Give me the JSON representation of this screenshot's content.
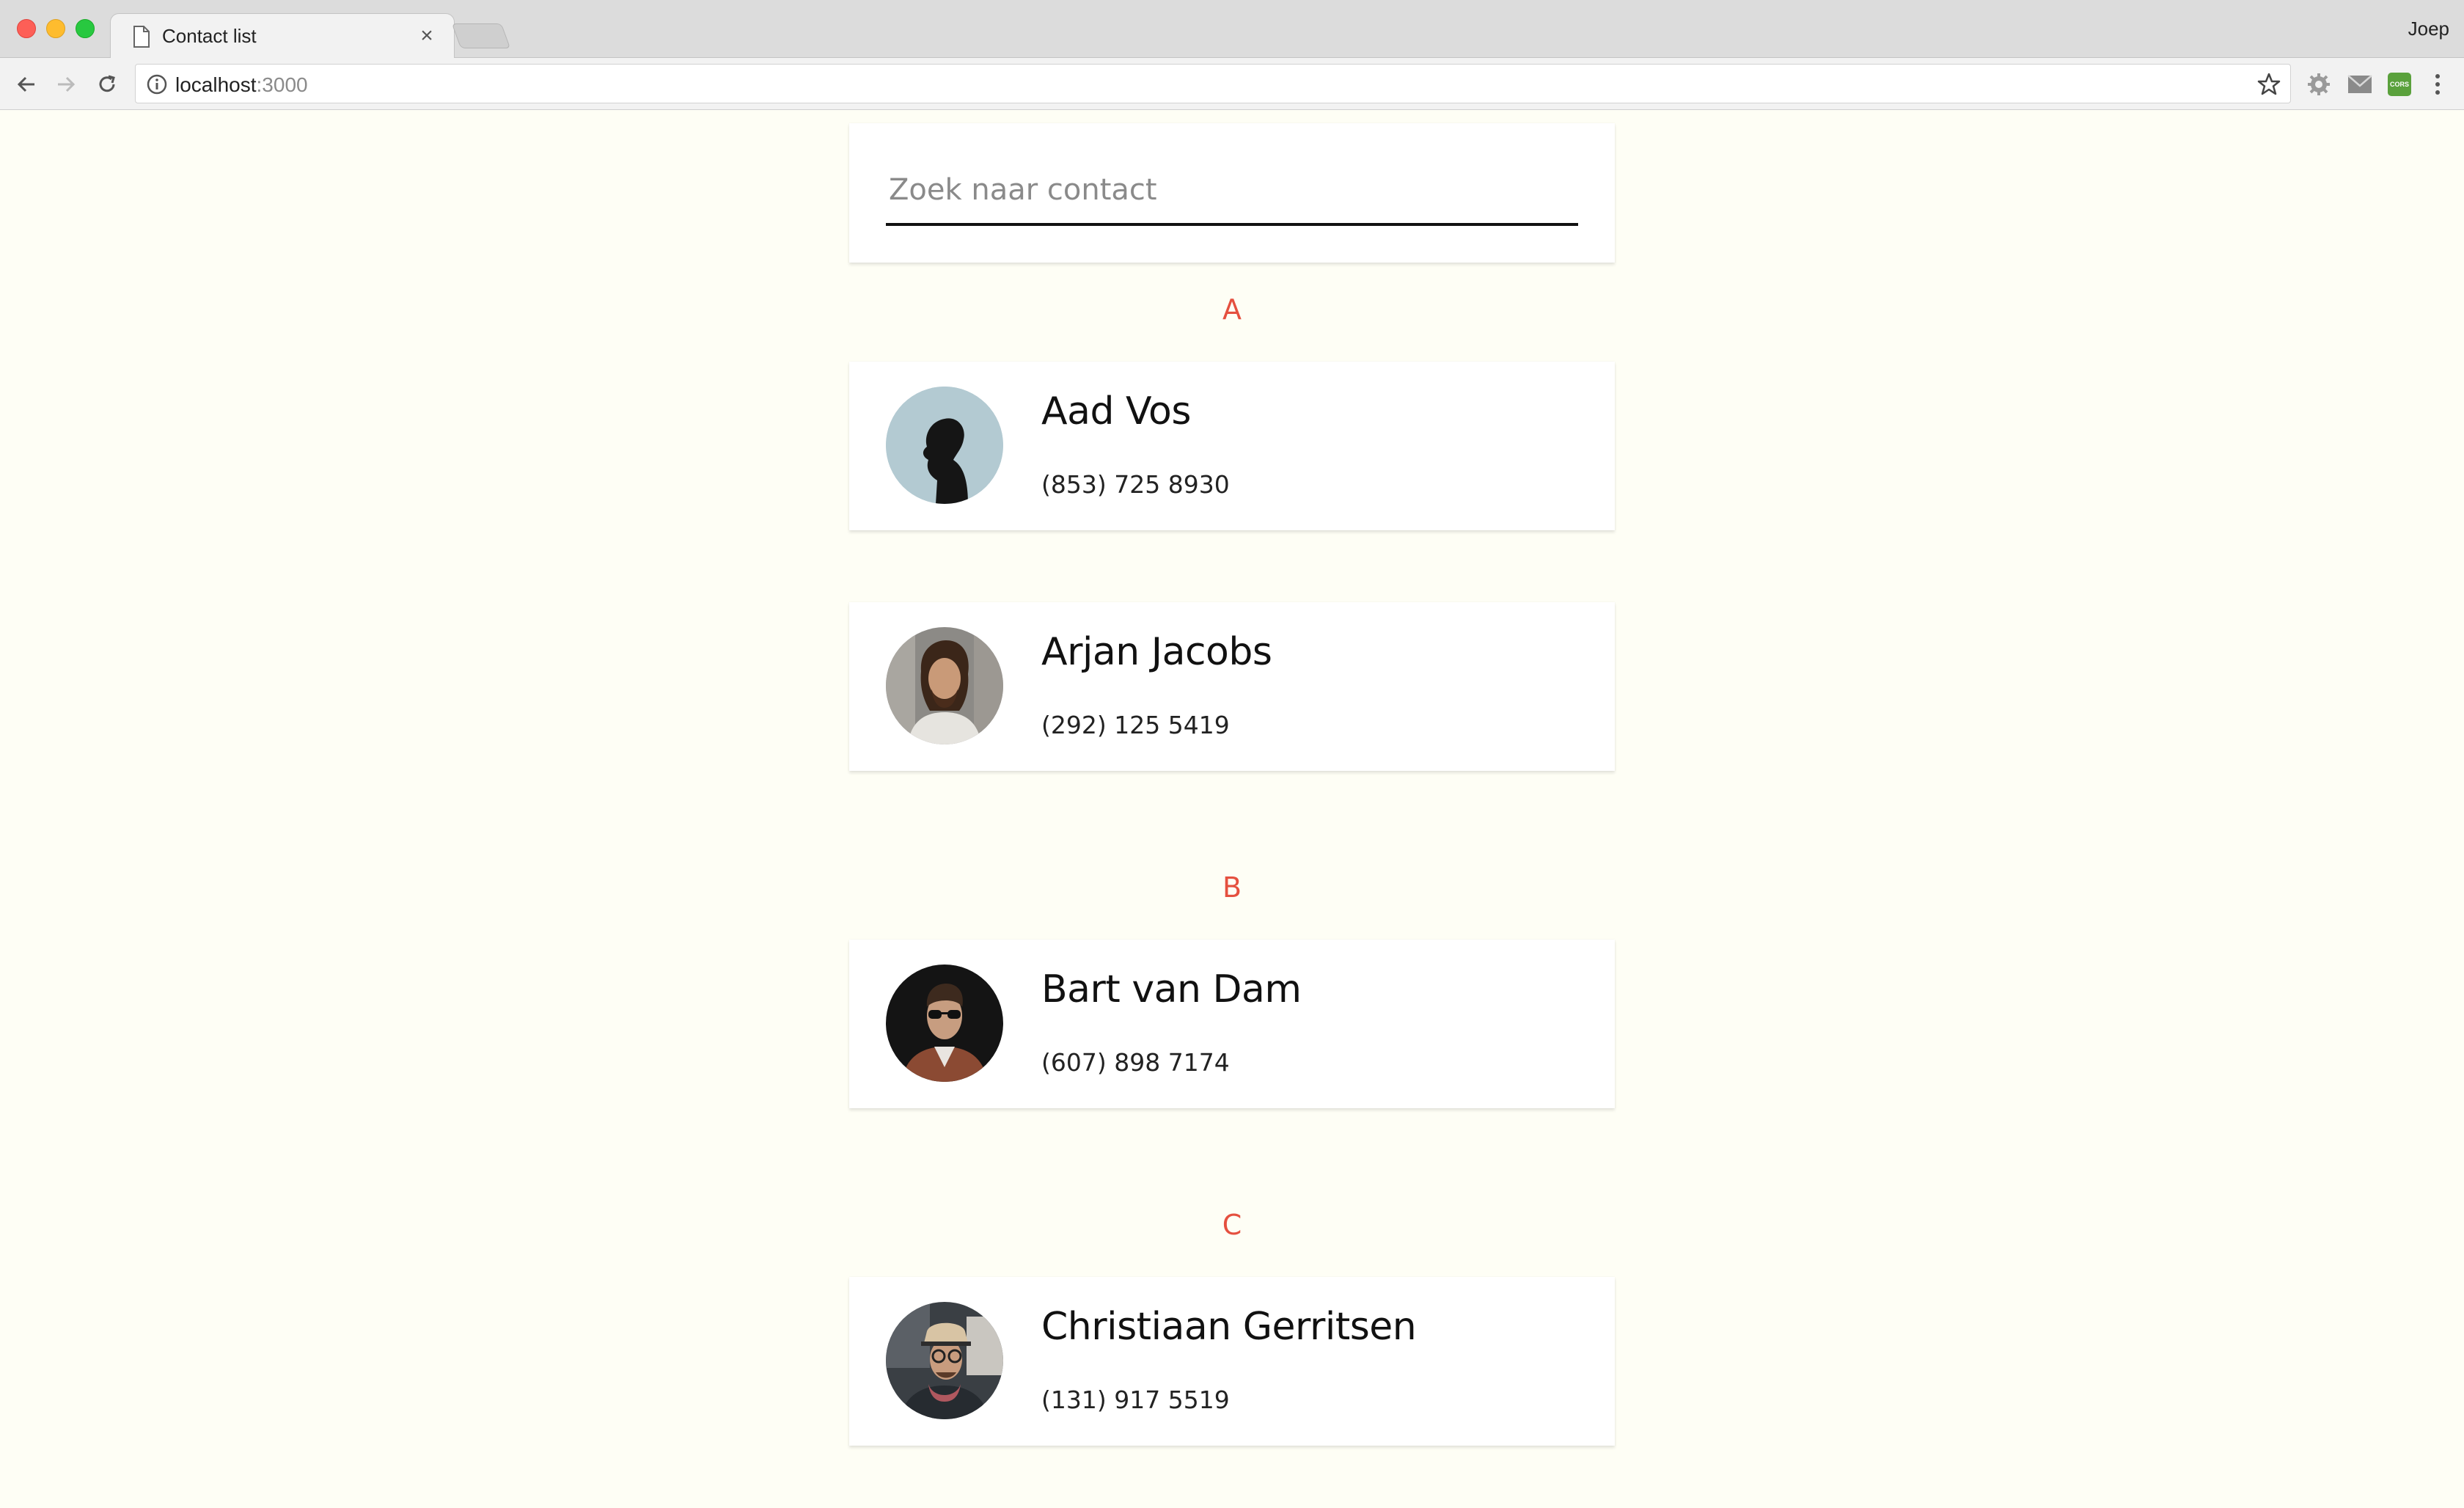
{
  "browser": {
    "tab_title": "Contact list",
    "tab_close": "×",
    "profile_name": "Joep",
    "url_host": "localhost",
    "url_port": ":3000",
    "extensions": [
      "settings-extension",
      "mail-extension",
      "cors-extension"
    ],
    "cors_label": "CORS"
  },
  "search": {
    "placeholder": "Zoek naar contact",
    "value": ""
  },
  "sections": [
    {
      "letter": "A",
      "contacts": [
        {
          "name": "Aad Vos",
          "phone": "(853) 725 8930"
        },
        {
          "name": "Arjan Jacobs",
          "phone": "(292) 125 5419"
        }
      ]
    },
    {
      "letter": "B",
      "contacts": [
        {
          "name": "Bart van Dam",
          "phone": "(607) 898 7174"
        }
      ]
    },
    {
      "letter": "C",
      "contacts": [
        {
          "name": "Christiaan Gerritsen",
          "phone": "(131) 917 5519"
        }
      ]
    }
  ],
  "colors": {
    "page_background": "#fefef5",
    "section_letter": "#e5503f",
    "card_background": "#ffffff"
  }
}
